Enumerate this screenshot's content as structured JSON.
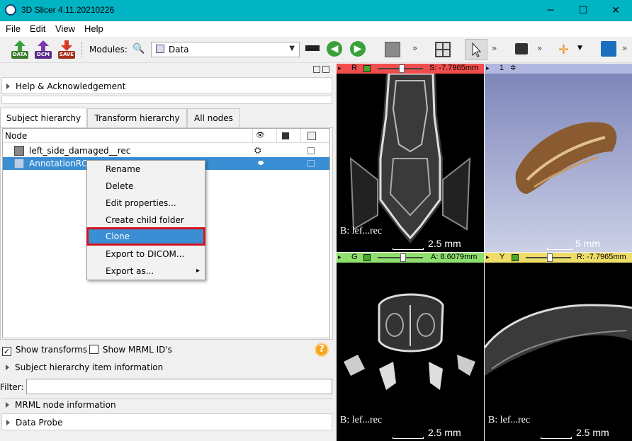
{
  "window": {
    "title": "3D Slicer 4.11.20210226",
    "minimize": "─",
    "maximize": "☐",
    "close": "✕"
  },
  "menu": {
    "items": [
      "File",
      "Edit",
      "View",
      "Help"
    ]
  },
  "toolbar": {
    "data_label": "DATA",
    "dcm_label": "DCM",
    "save_label": "SAVE",
    "modules_label": "Modules:",
    "module_value": "Data",
    "more": "»"
  },
  "panel": {
    "float_icon": "◙",
    "close_icon": "☒",
    "help_section": "Help & Acknowledgement",
    "tabs": [
      "Subject hierarchy",
      "Transform hierarchy",
      "All nodes"
    ],
    "tree_header": "Node",
    "rows": [
      {
        "label": "left_side_damaged__rec",
        "selected": false
      },
      {
        "label": "AnnotationROI",
        "selected": true
      }
    ],
    "show_transforms_label": "Show transforms",
    "show_transforms_checked": true,
    "show_mrml_ids_label": "Show MRML ID's",
    "show_mrml_ids_checked": false,
    "item_info_section": "Subject hierarchy item information",
    "filter_label": "Filter:",
    "filter_value": "",
    "mrml_info_section": "MRML node information",
    "data_probe_section": "Data Probe"
  },
  "context_menu": {
    "items": [
      "Rename",
      "Delete",
      "Edit properties...",
      "Create child folder",
      "Clone",
      "Export to DICOM...",
      "Export as..."
    ],
    "highlighted": "Clone",
    "submenu_arrow": "▸"
  },
  "views": {
    "red": {
      "letter": "R",
      "offset": "S: -7.7965mm",
      "label": "B: lef...rec",
      "scale": "2.5 mm",
      "bar_color": "#f04e4e"
    },
    "three_d": {
      "number": "1",
      "scale": "5 mm",
      "bar_color": "#b0b8e0"
    },
    "green": {
      "letter": "G",
      "offset": "A: 8.6079mm",
      "label": "B: lef...rec",
      "scale": "2.5 mm",
      "bar_color": "#8ee06e"
    },
    "yellow": {
      "letter": "Y",
      "offset": "R: -7.7965mm",
      "label": "B: lef...rec",
      "scale": "2.5 mm",
      "bar_color": "#eede68"
    }
  },
  "help_button_icon": "?"
}
